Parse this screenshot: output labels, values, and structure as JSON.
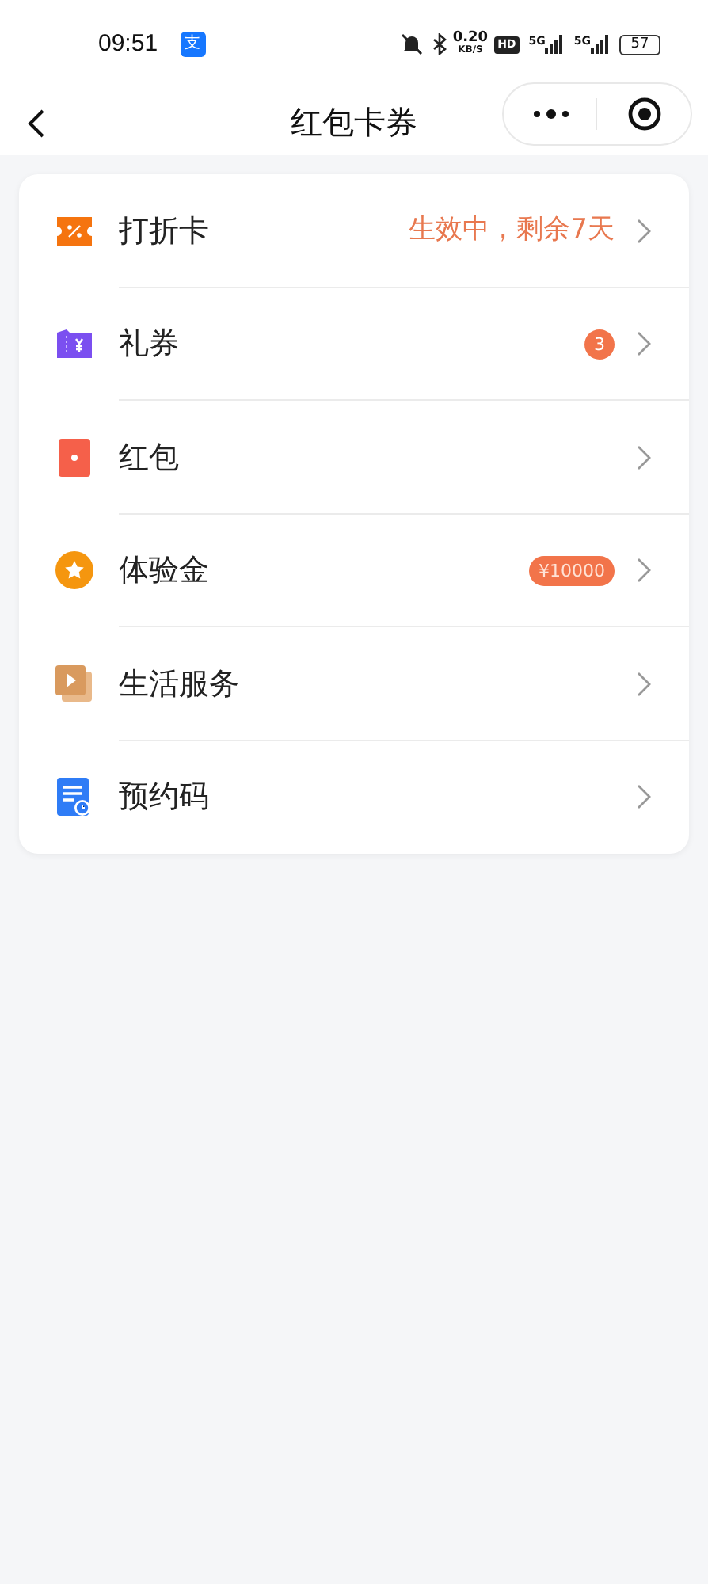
{
  "status_bar": {
    "time": "09:51",
    "app_glyph": "支",
    "speed": "0.20",
    "speed_unit": "KB/S",
    "hd": "HD",
    "signals": [
      "5G",
      "5G"
    ],
    "battery": "57"
  },
  "nav": {
    "title": "红包卡券"
  },
  "items": [
    {
      "label": "打折卡",
      "kind": "discount",
      "trailing": {
        "kind": "text",
        "text": "生效中，剩余7天"
      }
    },
    {
      "label": "礼券",
      "kind": "voucher",
      "trailing": {
        "kind": "badge",
        "text": "3"
      }
    },
    {
      "label": "红包",
      "kind": "redpacket"
    },
    {
      "label": "体验金",
      "kind": "star",
      "trailing": {
        "kind": "tag",
        "text": "¥10000"
      }
    },
    {
      "label": "生活服务",
      "kind": "play"
    },
    {
      "label": "预约码",
      "kind": "booking"
    }
  ]
}
